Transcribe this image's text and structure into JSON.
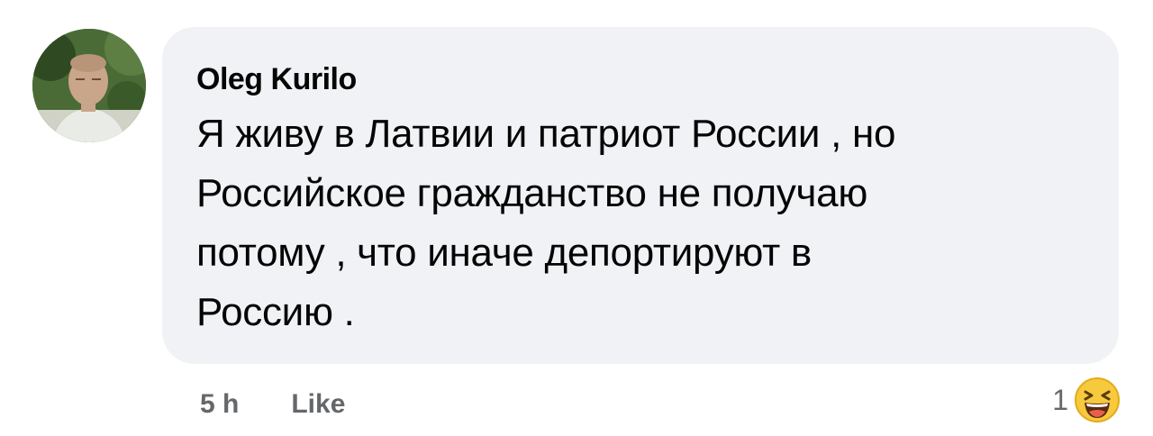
{
  "comment": {
    "author": "Oleg  Kurilo",
    "text": "Я живу в Латвии и патриот России , но\nРоссийское гражданство не получаю\nпотому , что иначе депортируют в\nРоссию .",
    "time": "5 h",
    "like_label": "Like",
    "reaction_count": "1",
    "reaction_icon": "laughing-emoji-icon",
    "bubble_color": "#f0f2f5",
    "meta_color": "#65676b"
  }
}
